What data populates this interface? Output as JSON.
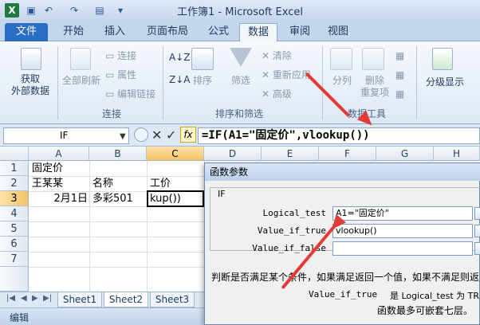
{
  "window": {
    "title": "工作簿1 - Microsoft Excel"
  },
  "ribbon_tabs": [
    "文件",
    "开始",
    "插入",
    "页面布局",
    "公式",
    "数据",
    "审阅",
    "视图"
  ],
  "active_tab": "数据",
  "ribbon": {
    "get_external": [
      "获取",
      "外部数据"
    ],
    "refresh_all": "全部刷新",
    "connections": "连接",
    "properties": "属性",
    "edit_links": "编辑链接",
    "group_connections": "连接",
    "sort": "排序",
    "filter": "筛选",
    "clear": "清除",
    "reapply": "重新应用",
    "advanced": "高级",
    "group_sort_filter": "排序和筛选",
    "text_to_columns": "分列",
    "remove_duplicates": [
      "删除",
      "重复项"
    ],
    "group_data_tools": "数据工具",
    "outline": "分级显示"
  },
  "formula_bar": {
    "name_box": "IF",
    "fx": "fx",
    "formula": "=IF(A1=\"固定价\",vlookup())"
  },
  "columns": [
    "A",
    "B",
    "C",
    "D",
    "E",
    "F",
    "G",
    "H"
  ],
  "rows": [
    "1",
    "2",
    "3",
    "4",
    "5",
    "6",
    "7"
  ],
  "cells": {
    "A1": "固定价",
    "A2": "王某某",
    "B2": "名称",
    "C2": "工价",
    "A3": "2月1日",
    "B3": "多彩501",
    "C3": "kup())"
  },
  "sheets": [
    "Sheet1",
    "Sheet2",
    "Sheet3"
  ],
  "active_sheet": "Sheet2",
  "status": "编辑",
  "dialog": {
    "title": "函数参数",
    "function": "IF",
    "args": [
      {
        "label": "Logical_test",
        "value": "A1=\"固定价\""
      },
      {
        "label": "Value_if_true",
        "value": "vlookup()"
      },
      {
        "label": "Value_if_false",
        "value": ""
      }
    ],
    "description": "判断是否满足某个条件，如果满足返回一个值，如果不满足则返",
    "help_label": "Value_if_true",
    "help_text": "是 Logical_test 为 TR",
    "nest_note": "函数最多可嵌套七层。"
  },
  "colors": {
    "accent": "#2b6cc4",
    "arrow": "#e53935",
    "selected_header": "#f4c466"
  }
}
